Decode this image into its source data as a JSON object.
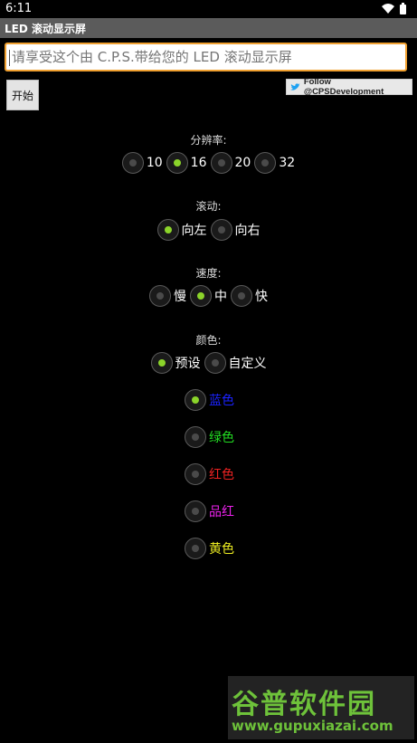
{
  "status_bar": {
    "time": "6:11",
    "icons": [
      "wifi-icon",
      "battery-icon"
    ]
  },
  "app": {
    "title": "LED 滚动显示屏"
  },
  "input": {
    "placeholder": "请享受这个由 C.P.S.带给您的 LED 滚动显示屏",
    "value": ""
  },
  "buttons": {
    "start": "开始",
    "follow": "Follow @CPSDevelopment"
  },
  "resolution": {
    "label": "分辨率:",
    "options": [
      "10",
      "16",
      "20",
      "32"
    ],
    "selected": "16"
  },
  "scroll": {
    "label": "滚动:",
    "options": [
      "向左",
      "向右"
    ],
    "selected": "向左"
  },
  "speed": {
    "label": "速度:",
    "options": [
      "慢",
      "中",
      "快"
    ],
    "selected": "中"
  },
  "color_mode": {
    "label": "颜色:",
    "options": [
      "预设",
      "自定义"
    ],
    "selected": "预设"
  },
  "preset_colors": [
    {
      "label": "蓝色",
      "color": "#1a22ff",
      "selected": true
    },
    {
      "label": "绿色",
      "color": "#22dd22",
      "selected": false
    },
    {
      "label": "红色",
      "color": "#ee2222",
      "selected": false
    },
    {
      "label": "品红",
      "color": "#ee22ee",
      "selected": false
    },
    {
      "label": "黄色",
      "color": "#eeee22",
      "selected": false
    }
  ],
  "colors": {
    "accent_radio": "#8bd42a",
    "input_border": "#f0a030",
    "titlebar": "#5b5b5b"
  },
  "watermark": {
    "title": "谷普软件园",
    "url": "www.gupuxiazai.com"
  }
}
